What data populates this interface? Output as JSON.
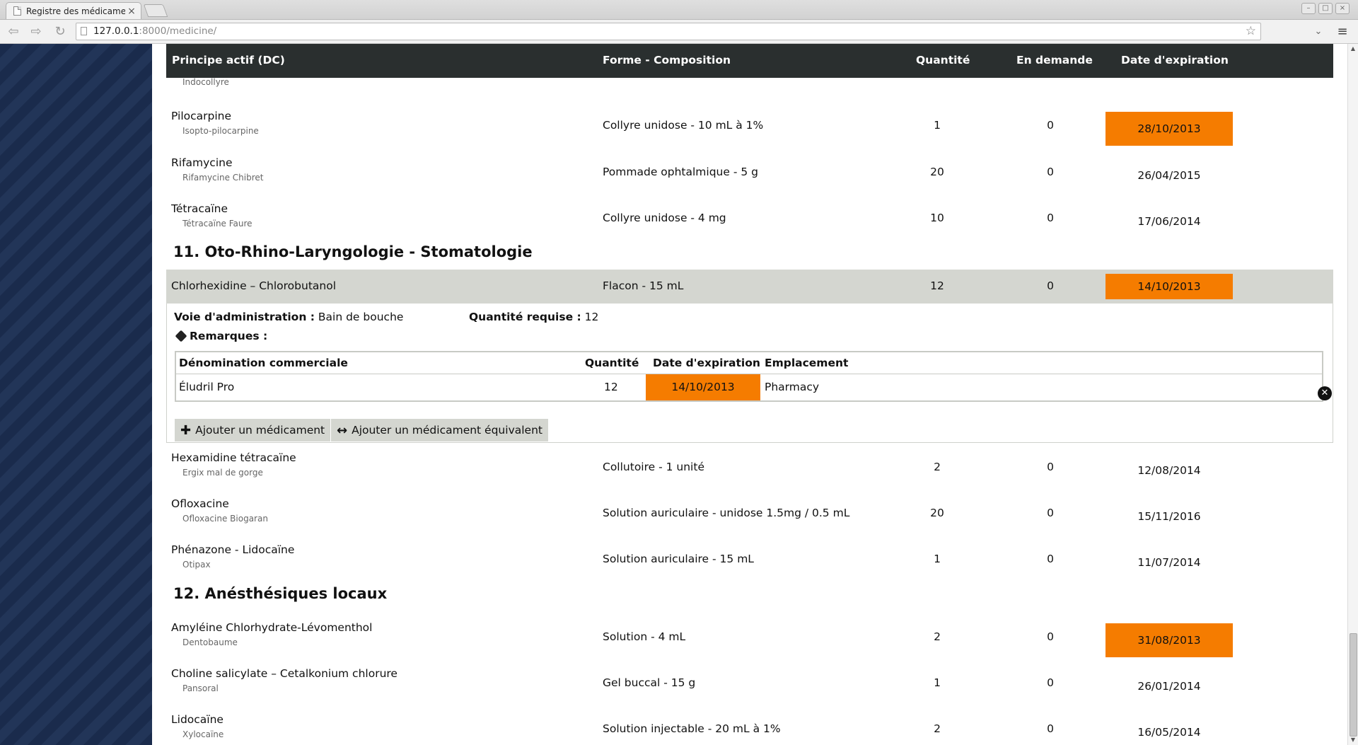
{
  "browser": {
    "tab_title": "Registre des médicaments",
    "tab_close": "×",
    "url_host": "127.0.0.1",
    "url_rest": ":8000/medicine/",
    "star": "☆"
  },
  "table": {
    "headers": {
      "principe": "Principe actif (DC)",
      "forme": "Forme - Composition",
      "quantite": "Quantité",
      "demande": "En demande",
      "expiration": "Date d'expiration"
    }
  },
  "partial_row": {
    "brand": "Indocollyre"
  },
  "rows_a": [
    {
      "dci": "Pilocarpine",
      "brand": "Isopto-pilocarpine",
      "forme": "Collyre unidose - 10 mL à 1%",
      "qte": "1",
      "dem": "0",
      "exp": "28/10/2013",
      "expired": true
    },
    {
      "dci": "Rifamycine",
      "brand": "Rifamycine Chibret",
      "forme": "Pommade ophtalmique - 5 g",
      "qte": "20",
      "dem": "0",
      "exp": "26/04/2015",
      "expired": false
    },
    {
      "dci": "Tétracaïne",
      "brand": "Tétracaïne Faure",
      "forme": "Collyre unidose - 4 mg",
      "qte": "10",
      "dem": "0",
      "exp": "17/06/2014",
      "expired": false
    }
  ],
  "category_11": "11. Oto-Rhino-Laryngologie - Stomatologie",
  "selected": {
    "dci": "Chlorhexidine – Chlorobutanol",
    "forme": "Flacon - 15 mL",
    "qte": "12",
    "dem": "0",
    "exp": "14/10/2013",
    "route_label": "Voie d'administration :",
    "route_value": "Bain de bouche",
    "reqqty_label": "Quantité requise :",
    "reqqty_value": "12",
    "remarks_label": "Remarques :",
    "sub_headers": {
      "denomination": "Dénomination commerciale",
      "quantite": "Quantité",
      "expiration": "Date d'expiration",
      "emplacement": "Emplacement"
    },
    "sub_row": {
      "denomination": "Éludril Pro",
      "quantite": "12",
      "expiration": "14/10/2013",
      "emplacement": "Pharmacy"
    },
    "btn_add": "Ajouter un médicament",
    "btn_add_equiv": "Ajouter un médicament équivalent"
  },
  "rows_b": [
    {
      "dci": "Hexamidine tétracaïne",
      "brand": "Ergix mal de gorge",
      "forme": "Collutoire - 1 unité",
      "qte": "2",
      "dem": "0",
      "exp": "12/08/2014",
      "expired": false
    },
    {
      "dci": "Ofloxacine",
      "brand": "Ofloxacine Biogaran",
      "forme": "Solution auriculaire - unidose 1.5mg / 0.5 mL",
      "qte": "20",
      "dem": "0",
      "exp": "15/11/2016",
      "expired": false
    },
    {
      "dci": "Phénazone - Lidocaïne",
      "brand": "Otipax",
      "forme": "Solution auriculaire - 15 mL",
      "qte": "1",
      "dem": "0",
      "exp": "11/07/2014",
      "expired": false
    }
  ],
  "category_12": "12. Anésthésiques locaux",
  "rows_c": [
    {
      "dci": "Amyléine Chlorhydrate-Lévomenthol",
      "brand": "Dentobaume",
      "forme": "Solution - 4 mL",
      "qte": "2",
      "dem": "0",
      "exp": "31/08/2013",
      "expired": true
    },
    {
      "dci": "Choline salicylate – Cetalkonium chlorure",
      "brand": "Pansoral",
      "forme": "Gel buccal - 15 g",
      "qte": "1",
      "dem": "0",
      "exp": "26/01/2014",
      "expired": false
    },
    {
      "dci": "Lidocaïne",
      "brand": "Xylocaïne",
      "forme": "Solution injectable - 20 mL à 1%",
      "qte": "2",
      "dem": "0",
      "exp": "16/05/2014",
      "expired": false
    }
  ],
  "colors": {
    "expired": "#f57c00",
    "header": "#2a2f2f",
    "sidebar": "#1a2b4c",
    "selected_row": "#d4d6d0"
  },
  "icons": {
    "back": "back-arrow-icon",
    "forward": "forward-arrow-icon",
    "reload": "reload-icon",
    "menu": "hamburger-menu-icon"
  }
}
